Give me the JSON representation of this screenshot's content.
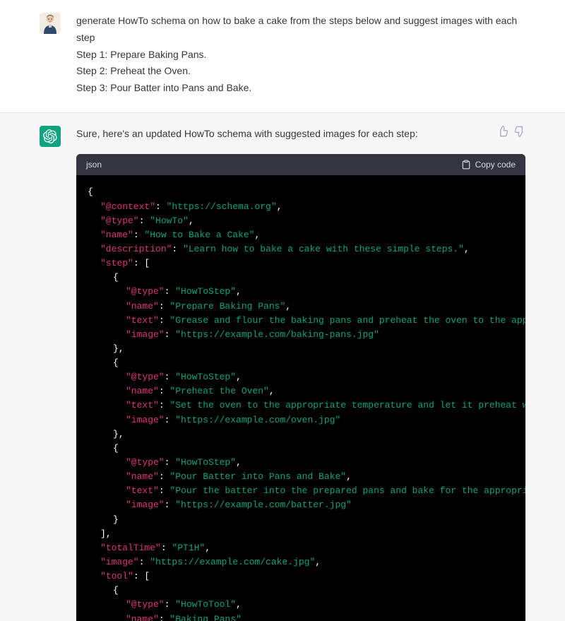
{
  "user_message": {
    "lines": [
      "generate HowTo schema on how to bake a cake from the steps below and suggest images with each step",
      "Step 1: Prepare Baking Pans.",
      "Step 2: Preheat the Oven.",
      "Step 3: Pour Batter into Pans and Bake."
    ]
  },
  "assistant_message": {
    "intro": "Sure, here's an updated HowTo schema with suggested images for each step:"
  },
  "code_block": {
    "lang_label": "json",
    "copy_label": "Copy code",
    "tokens": [
      [
        {
          "c": "p",
          "t": "{"
        }
      ],
      [
        {
          "c": "k",
          "t": "\"@context\""
        },
        {
          "c": "p",
          "t": ": "
        },
        {
          "c": "s",
          "t": "\"https://schema.org\""
        },
        {
          "c": "p",
          "t": ","
        }
      ],
      [
        {
          "c": "k",
          "t": "\"@type\""
        },
        {
          "c": "p",
          "t": ": "
        },
        {
          "c": "s",
          "t": "\"HowTo\""
        },
        {
          "c": "p",
          "t": ","
        }
      ],
      [
        {
          "c": "k",
          "t": "\"name\""
        },
        {
          "c": "p",
          "t": ": "
        },
        {
          "c": "s",
          "t": "\"How to Bake a Cake\""
        },
        {
          "c": "p",
          "t": ","
        }
      ],
      [
        {
          "c": "k",
          "t": "\"description\""
        },
        {
          "c": "p",
          "t": ": "
        },
        {
          "c": "s",
          "t": "\"Learn how to bake a cake with these simple steps.\""
        },
        {
          "c": "p",
          "t": ","
        }
      ],
      [
        {
          "c": "k",
          "t": "\"step\""
        },
        {
          "c": "p",
          "t": ": ["
        }
      ],
      [
        {
          "c": "p",
          "t": "{"
        }
      ],
      [
        {
          "c": "k",
          "t": "\"@type\""
        },
        {
          "c": "p",
          "t": ": "
        },
        {
          "c": "s",
          "t": "\"HowToStep\""
        },
        {
          "c": "p",
          "t": ","
        }
      ],
      [
        {
          "c": "k",
          "t": "\"name\""
        },
        {
          "c": "p",
          "t": ": "
        },
        {
          "c": "s",
          "t": "\"Prepare Baking Pans\""
        },
        {
          "c": "p",
          "t": ","
        }
      ],
      [
        {
          "c": "k",
          "t": "\"text\""
        },
        {
          "c": "p",
          "t": ": "
        },
        {
          "c": "s",
          "t": "\"Grease and flour the baking pans and preheat the oven to the appropr"
        }
      ],
      [
        {
          "c": "k",
          "t": "\"image\""
        },
        {
          "c": "p",
          "t": ": "
        },
        {
          "c": "s",
          "t": "\"https://example.com/baking-pans.jpg\""
        }
      ],
      [
        {
          "c": "p",
          "t": "},"
        }
      ],
      [
        {
          "c": "p",
          "t": "{"
        }
      ],
      [
        {
          "c": "k",
          "t": "\"@type\""
        },
        {
          "c": "p",
          "t": ": "
        },
        {
          "c": "s",
          "t": "\"HowToStep\""
        },
        {
          "c": "p",
          "t": ","
        }
      ],
      [
        {
          "c": "k",
          "t": "\"name\""
        },
        {
          "c": "p",
          "t": ": "
        },
        {
          "c": "s",
          "t": "\"Preheat the Oven\""
        },
        {
          "c": "p",
          "t": ","
        }
      ],
      [
        {
          "c": "k",
          "t": "\"text\""
        },
        {
          "c": "p",
          "t": ": "
        },
        {
          "c": "s",
          "t": "\"Set the oven to the appropriate temperature and let it preheat while"
        }
      ],
      [
        {
          "c": "k",
          "t": "\"image\""
        },
        {
          "c": "p",
          "t": ": "
        },
        {
          "c": "s",
          "t": "\"https://example.com/oven.jpg\""
        }
      ],
      [
        {
          "c": "p",
          "t": "},"
        }
      ],
      [
        {
          "c": "p",
          "t": "{"
        }
      ],
      [
        {
          "c": "k",
          "t": "\"@type\""
        },
        {
          "c": "p",
          "t": ": "
        },
        {
          "c": "s",
          "t": "\"HowToStep\""
        },
        {
          "c": "p",
          "t": ","
        }
      ],
      [
        {
          "c": "k",
          "t": "\"name\""
        },
        {
          "c": "p",
          "t": ": "
        },
        {
          "c": "s",
          "t": "\"Pour Batter into Pans and Bake\""
        },
        {
          "c": "p",
          "t": ","
        }
      ],
      [
        {
          "c": "k",
          "t": "\"text\""
        },
        {
          "c": "p",
          "t": ": "
        },
        {
          "c": "s",
          "t": "\"Pour the batter into the prepared pans and bake for the appropriate "
        }
      ],
      [
        {
          "c": "k",
          "t": "\"image\""
        },
        {
          "c": "p",
          "t": ": "
        },
        {
          "c": "s",
          "t": "\"https://example.com/batter.jpg\""
        }
      ],
      [
        {
          "c": "p",
          "t": "}"
        }
      ],
      [
        {
          "c": "p",
          "t": "],"
        }
      ],
      [
        {
          "c": "k",
          "t": "\"totalTime\""
        },
        {
          "c": "p",
          "t": ": "
        },
        {
          "c": "s",
          "t": "\"PT1H\""
        },
        {
          "c": "p",
          "t": ","
        }
      ],
      [
        {
          "c": "k",
          "t": "\"image\""
        },
        {
          "c": "p",
          "t": ": "
        },
        {
          "c": "s",
          "t": "\"https://example.com/cake.jpg\""
        },
        {
          "c": "p",
          "t": ","
        }
      ],
      [
        {
          "c": "k",
          "t": "\"tool\""
        },
        {
          "c": "p",
          "t": ": ["
        }
      ],
      [
        {
          "c": "p",
          "t": "{"
        }
      ],
      [
        {
          "c": "k",
          "t": "\"@type\""
        },
        {
          "c": "p",
          "t": ": "
        },
        {
          "c": "s",
          "t": "\"HowToTool\""
        },
        {
          "c": "p",
          "t": ","
        }
      ],
      [
        {
          "c": "k",
          "t": "\"name\""
        },
        {
          "c": "p",
          "t": ": "
        },
        {
          "c": "s",
          "t": "\"Baking Pans\""
        }
      ]
    ],
    "indents": [
      1,
      2,
      2,
      2,
      2,
      2,
      3,
      4,
      4,
      4,
      4,
      3,
      3,
      4,
      4,
      4,
      4,
      3,
      3,
      4,
      4,
      4,
      4,
      3,
      2,
      2,
      2,
      2,
      3,
      4,
      4
    ]
  }
}
